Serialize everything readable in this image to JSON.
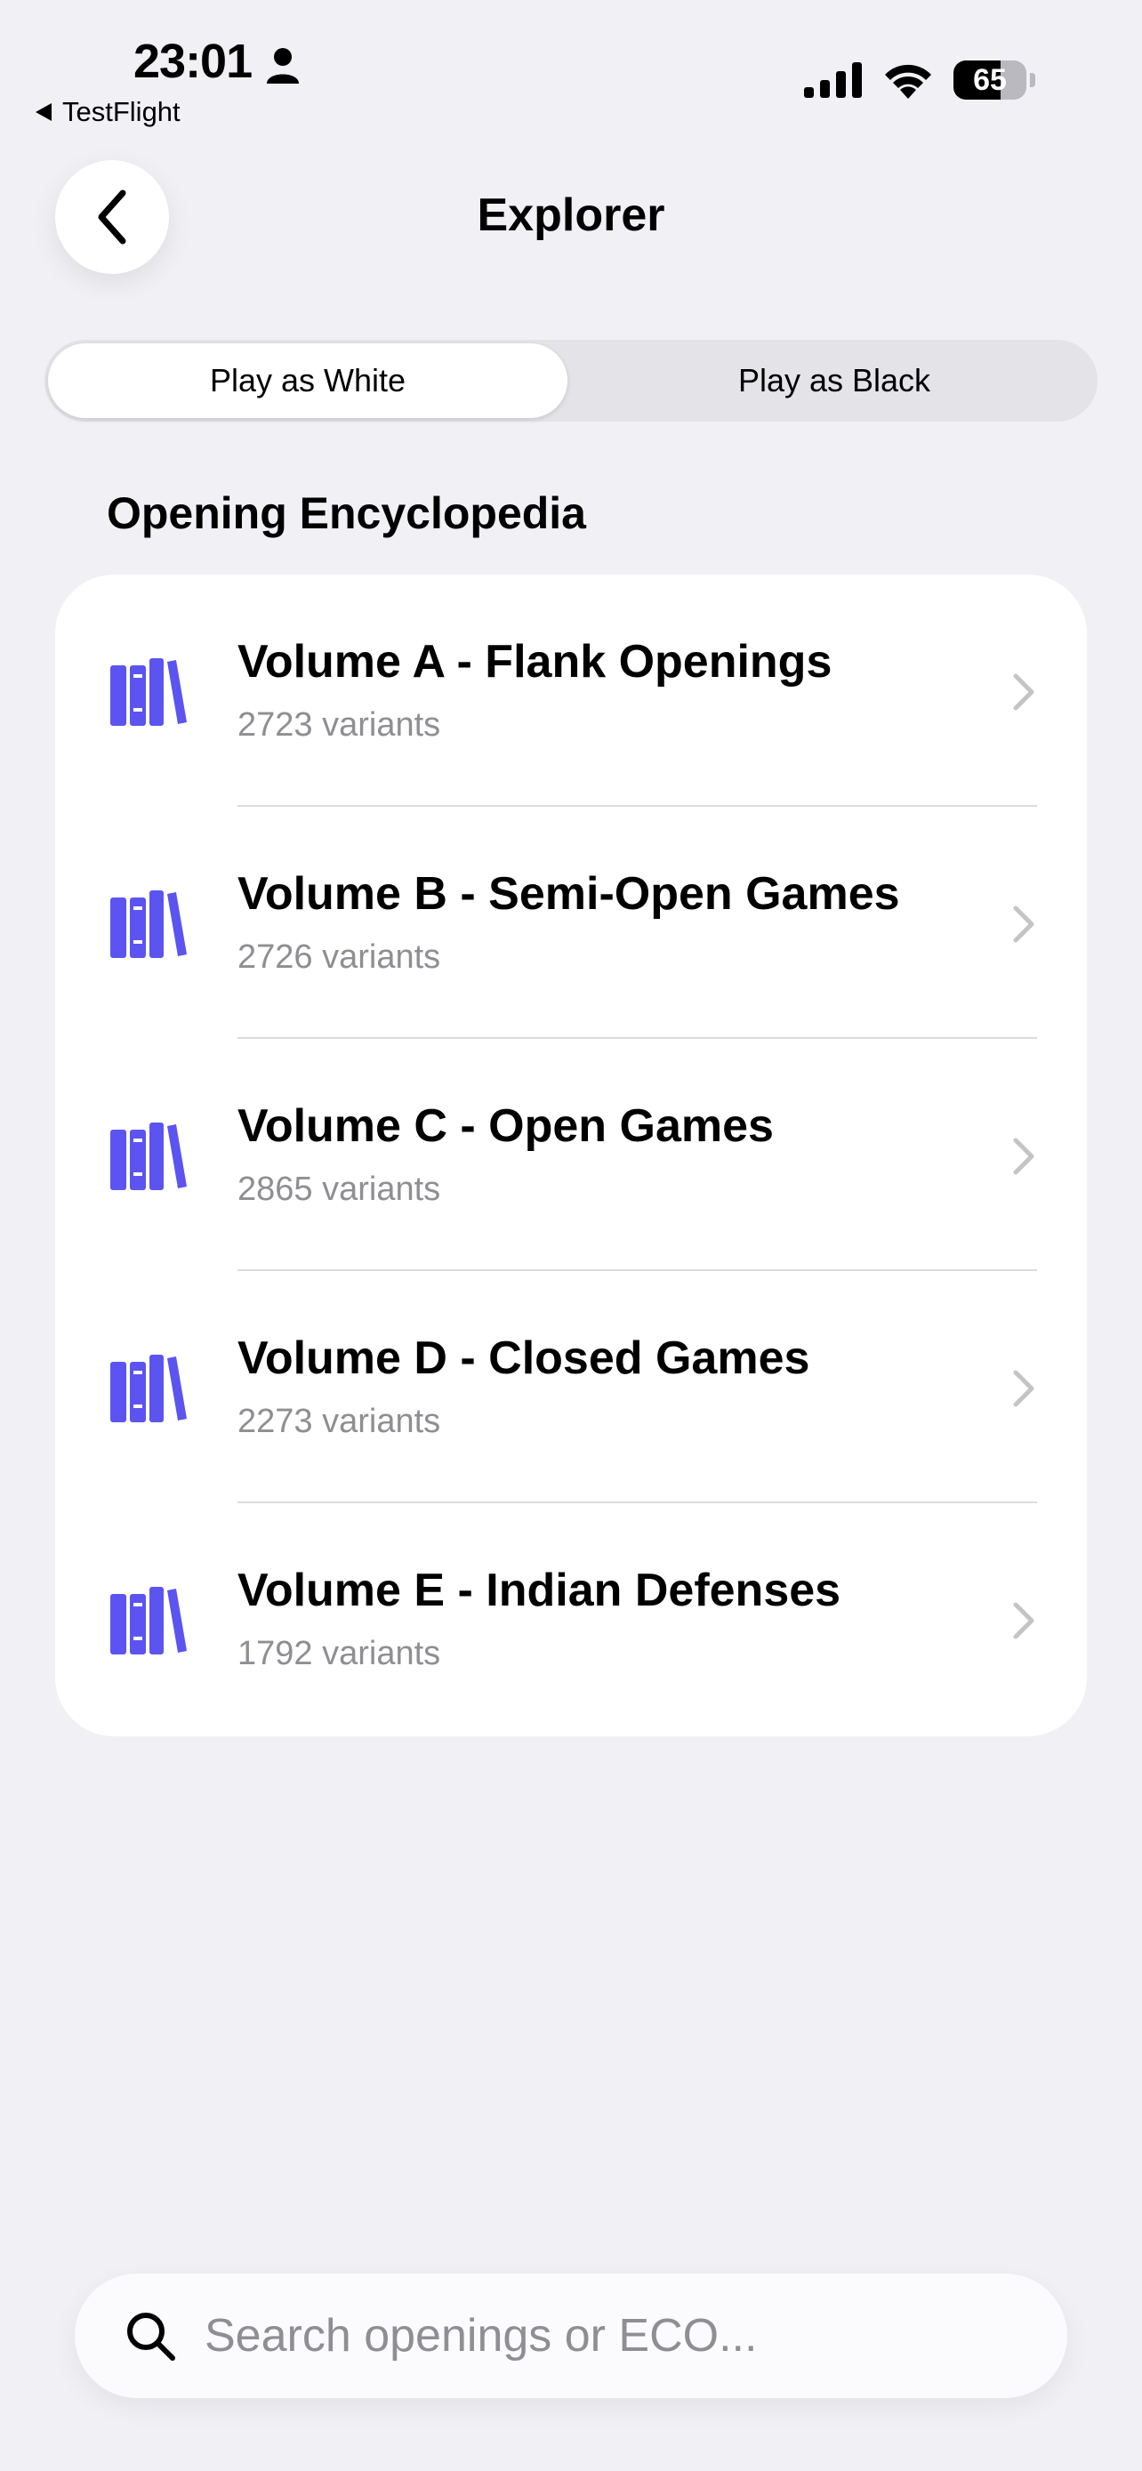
{
  "status_bar": {
    "time": "23:01",
    "back_app": "TestFlight",
    "battery": "65",
    "battery_level": 0.65
  },
  "nav": {
    "title": "Explorer",
    "back_icon": "chevron-left-icon"
  },
  "segments": {
    "white": "Play as White",
    "black": "Play as Black",
    "selected": "white"
  },
  "section": {
    "title": "Opening Encyclopedia"
  },
  "volumes": [
    {
      "title": "Volume A - Flank Openings",
      "subtitle": "2723 variants"
    },
    {
      "title": "Volume B - Semi-Open Games",
      "subtitle": "2726 variants"
    },
    {
      "title": "Volume C - Open Games",
      "subtitle": "2865 variants"
    },
    {
      "title": "Volume D - Closed Games",
      "subtitle": "2273 variants"
    },
    {
      "title": "Volume E - Indian Defenses",
      "subtitle": "1792 variants"
    }
  ],
  "search": {
    "placeholder": "Search openings or ECO...",
    "value": ""
  },
  "colors": {
    "accent": "#5b54f0",
    "background": "#f0f0f5",
    "secondary_text": "#8e8e93",
    "chevron": "#c4c4c8"
  }
}
